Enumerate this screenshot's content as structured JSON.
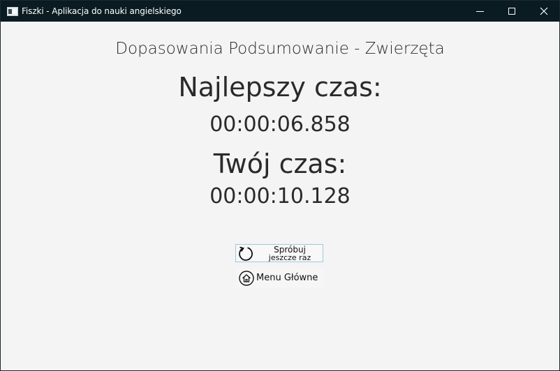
{
  "window": {
    "title": "Fiszki - Aplikacja do nauki angielskiego"
  },
  "summary": {
    "title": "Dopasowania Podsumowanie - Zwierzęta",
    "best_time_label": "Najlepszy czas:",
    "best_time_value": "00:00:06.858",
    "your_time_label": "Twój czas:",
    "your_time_value": "00:00:10.128"
  },
  "actions": {
    "retry_line1": "Spróbuj",
    "retry_line2": "jeszcze raz",
    "retry_icon": "refresh-icon",
    "menu_label": "Menu Główne",
    "menu_icon": "home-icon"
  },
  "colors": {
    "titlebar": "#0a1b21",
    "background": "#f4f4f4",
    "button_border": "#9fc8de"
  }
}
